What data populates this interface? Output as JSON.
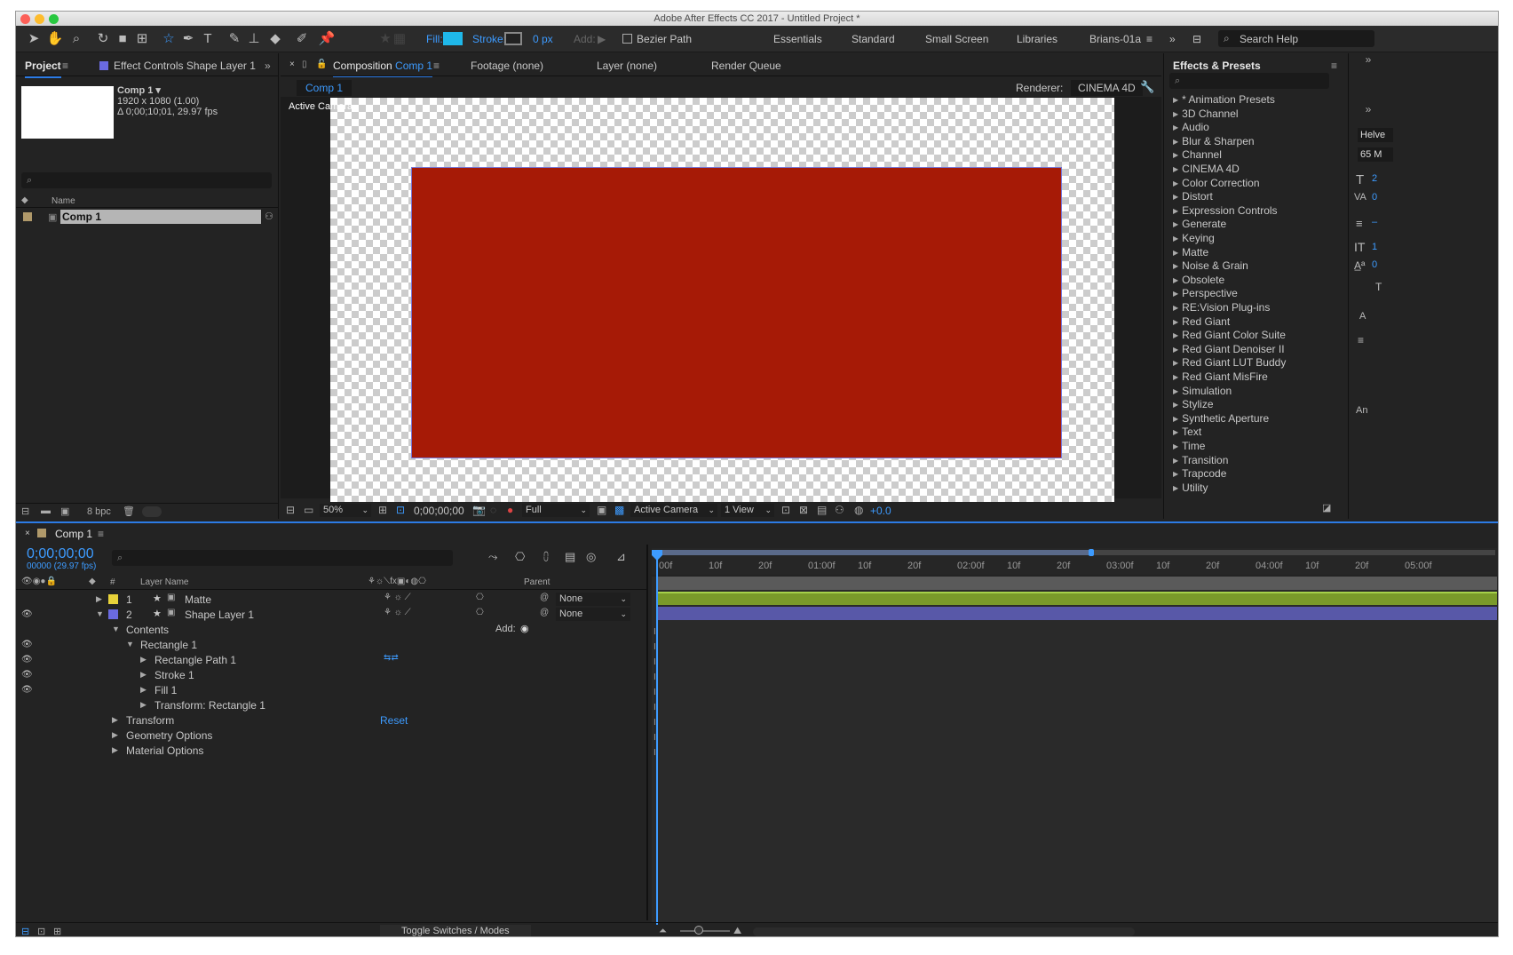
{
  "window": {
    "title": "Adobe After Effects CC 2017 - Untitled Project *"
  },
  "toolbar": {
    "tools": [
      "selection-tool",
      "hand-tool",
      "zoom-tool",
      "rotation-tool",
      "camera-tool",
      "pan-behind-tool",
      "star-tool",
      "pen-tool",
      "type-tool",
      "brush-tool",
      "clone-stamp-tool",
      "eraser-tool",
      "roto-brush-tool",
      "puppet-pin-tool"
    ],
    "fill_label": "Fill:",
    "fill_color": "#1fb8ea",
    "stroke_label": "Stroke:",
    "stroke_width": "0 px",
    "add_label": "Add:",
    "bezier_label": "Bezier Path",
    "workspaces": [
      "Essentials",
      "Standard",
      "Small Screen",
      "Libraries"
    ],
    "active_workspace": "Brians-01a",
    "search_placeholder": "Search Help"
  },
  "project_panel": {
    "tab_project": "Project",
    "tab_effect_controls": "Effect Controls Shape Layer 1",
    "comp_name": "Comp 1 ▾",
    "comp_size": "1920 x 1080 (1.00)",
    "comp_duration": "Δ 0;00;10;01, 29.97 fps",
    "col_name": "Name",
    "item_name": "Comp 1",
    "bpc": "8 bpc"
  },
  "composition_panel": {
    "tab_composition_prefix": "Composition",
    "tab_composition_name": "Comp 1",
    "tab_footage": "Footage (none)",
    "tab_layer": "Layer (none)",
    "tab_render_queue": "Render Queue",
    "subtab": "Comp 1",
    "renderer_label": "Renderer:",
    "renderer_value": "CINEMA 4D",
    "active_camera_label": "Active Camera",
    "rect_color": "#a61a06",
    "zoom": "50%",
    "timecode": "0;00;00;00",
    "resolution": "Full",
    "camera": "Active Camera",
    "views": "1 View",
    "exposure": "+0.0"
  },
  "effects_panel": {
    "title": "Effects & Presets",
    "items": [
      "* Animation Presets",
      "3D Channel",
      "Audio",
      "Blur & Sharpen",
      "Channel",
      "CINEMA 4D",
      "Color Correction",
      "Distort",
      "Expression Controls",
      "Generate",
      "Keying",
      "Matte",
      "Noise & Grain",
      "Obsolete",
      "Perspective",
      "RE:Vision Plug-ins",
      "Red Giant",
      "Red Giant Color Suite",
      "Red Giant Denoiser II",
      "Red Giant LUT Buddy",
      "Red Giant MisFire",
      "Simulation",
      "Stylize",
      "Synthetic Aperture",
      "Text",
      "Time",
      "Transition",
      "Trapcode",
      "Utility"
    ]
  },
  "right_strip": {
    "font_name": "Helve",
    "font_style": "65 M",
    "v1": "2",
    "v2": "0",
    "v3": "–",
    "v4": "1",
    "v5": "0",
    "v6": "T",
    "a_label": "A",
    "an_label": "An"
  },
  "timeline": {
    "tab": "Comp 1",
    "timecode": "0;00;00;00",
    "frames": "00000 (29.97 fps)",
    "col_num": "#",
    "col_layer_name": "Layer Name",
    "col_parent": "Parent",
    "ruler": [
      "00f",
      "10f",
      "20f",
      "01:00f",
      "10f",
      "20f",
      "02:00f",
      "10f",
      "20f",
      "03:00f",
      "10f",
      "20f",
      "04:00f",
      "10f",
      "20f",
      "05:00f"
    ],
    "layers": [
      {
        "num": "1",
        "name": "Matte",
        "parent": "None",
        "color": "#e8d23a",
        "bar_color": "#7a9a2a"
      },
      {
        "num": "2",
        "name": "Shape Layer 1",
        "parent": "None",
        "color": "#6a6ae0",
        "bar_color": "#5858a8"
      }
    ],
    "contents_label": "Contents",
    "add_label": "Add:",
    "rectangle_label": "Rectangle 1",
    "rect_path_label": "Rectangle Path 1",
    "stroke_label": "Stroke 1",
    "fill_label": "Fill 1",
    "transform_rect_label": "Transform: Rectangle 1",
    "transform_label": "Transform",
    "reset_label": "Reset",
    "geometry_label": "Geometry Options",
    "material_label": "Material Options",
    "toggle_label": "Toggle Switches / Modes"
  }
}
